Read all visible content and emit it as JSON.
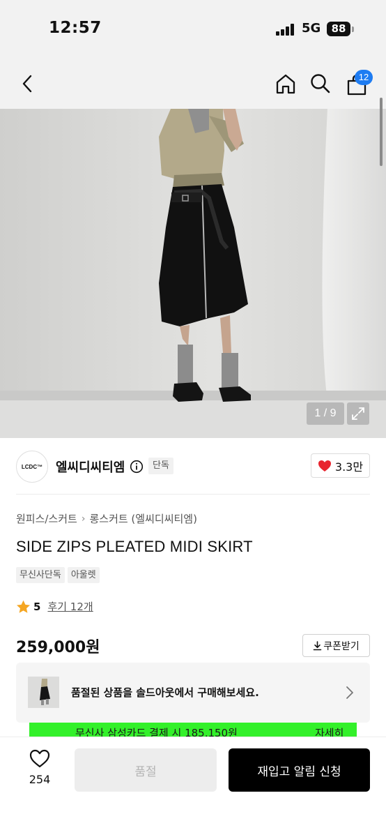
{
  "status_bar": {
    "time": "12:57",
    "network": "5G",
    "battery": "88"
  },
  "nav": {
    "cart_count": "12",
    "icons": [
      "back-icon",
      "home-icon",
      "search-icon",
      "cart-icon"
    ]
  },
  "gallery": {
    "counter": "1 / 9"
  },
  "brand": {
    "logo_text": "LCDC™",
    "name": "엘씨디씨티엠",
    "exclusive_tag": "단독",
    "likes": "3.3만"
  },
  "category": {
    "level1": "원피스/스커트",
    "level2": "롱스커트 (엘씨디씨티엠)"
  },
  "product": {
    "title": "SIDE ZIPS PLEATED MIDI SKIRT",
    "tags": [
      "무신사단독",
      "아울렛"
    ],
    "rating": "5",
    "review_text": "후기 12개",
    "price": "259,000원",
    "coupon_label": "쿠폰받기"
  },
  "soldout_banner": {
    "text": "품절된 상품을 솔드아웃에서 구매해보세요."
  },
  "promo": {
    "text": "무신사 삼성카드 결제 시 185,150원",
    "more": "자세히"
  },
  "bottom_bar": {
    "wish_count": "254",
    "soldout_label": "품절",
    "restock_label": "재입고 알림 신청"
  },
  "colors": {
    "accent_blue": "#1e7cf2",
    "promo_green": "#33f02a",
    "heart_red": "#e8242e"
  }
}
